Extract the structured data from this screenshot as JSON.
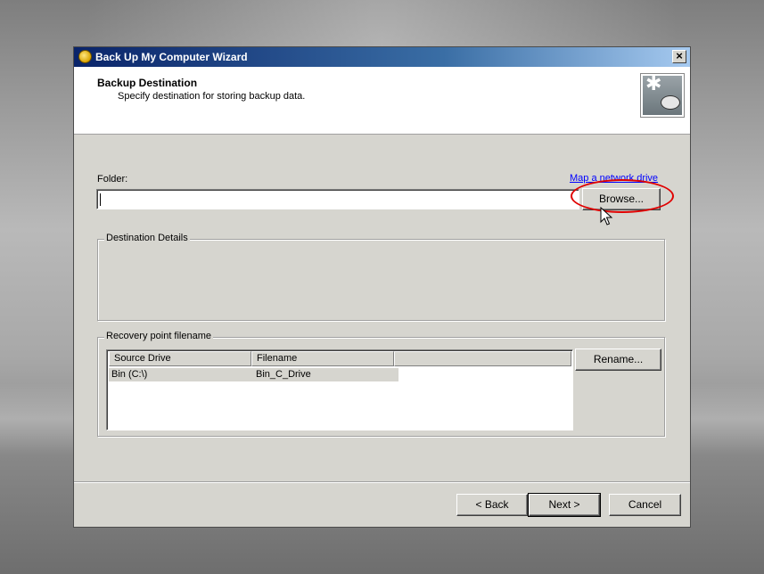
{
  "window": {
    "title": "Back Up My Computer Wizard",
    "close_glyph": "×",
    "icon": "backup-wizard-icon"
  },
  "header": {
    "title": "Backup Destination",
    "subtitle": "Specify destination for storing backup data.",
    "icon": "backup-destination-icon"
  },
  "folder": {
    "label": "Folder:",
    "value": "",
    "map_drive_link": "Map a network drive",
    "browse_button": "Browse..."
  },
  "destination_details": {
    "label": "Destination Details"
  },
  "recovery": {
    "label": "Recovery point filename",
    "columns": [
      "Source Drive",
      "Filename",
      ""
    ],
    "rows": [
      {
        "source_drive": "Bin (C:\\)",
        "filename": "Bin_C_Drive"
      }
    ],
    "rename_button": "Rename..."
  },
  "footer": {
    "back_button": "< Back",
    "next_button": "Next >",
    "cancel_button": "Cancel"
  },
  "annotation": {
    "highlight_color": "#e00000",
    "highlight_target": "browse-button"
  }
}
